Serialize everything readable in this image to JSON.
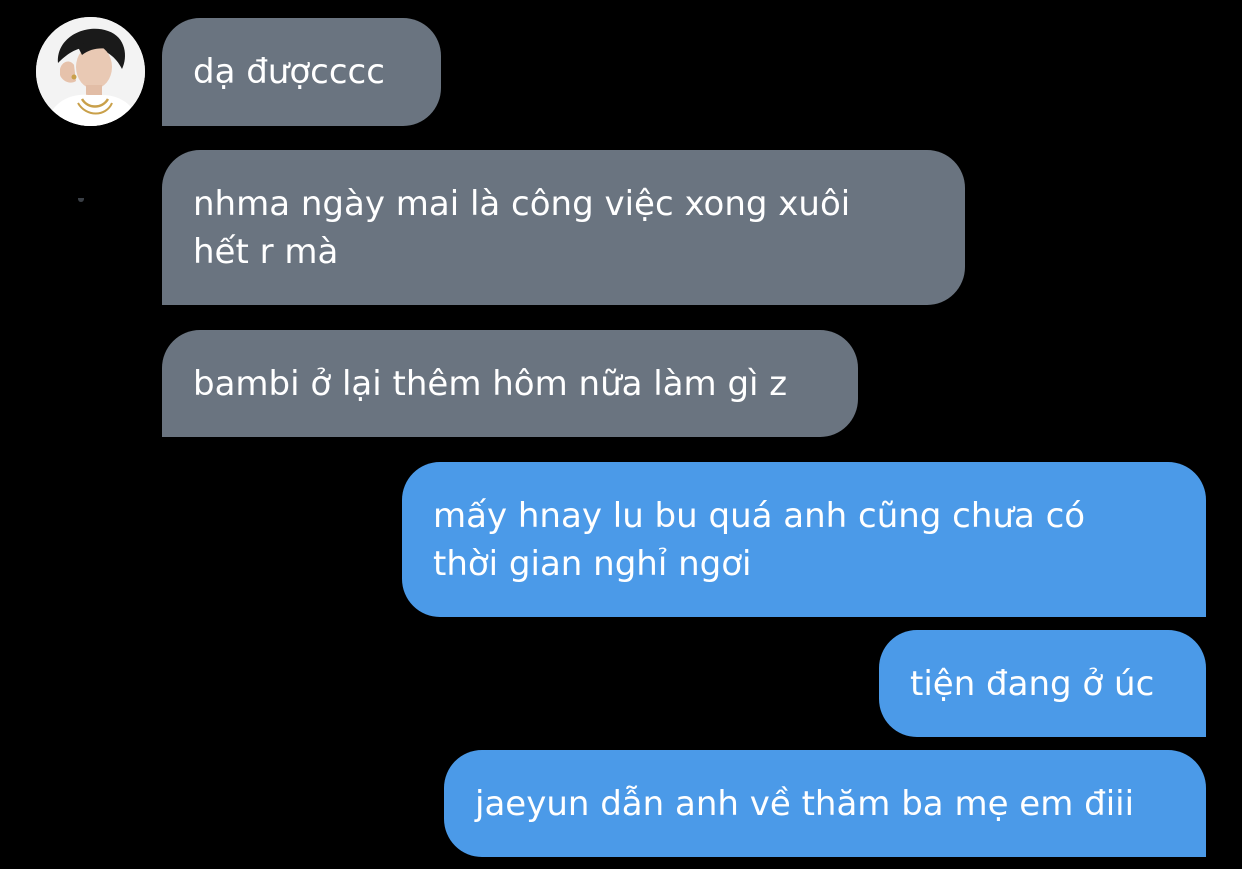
{
  "conversation": {
    "contact": {
      "avatar_icon": "profile-photo"
    },
    "messages": [
      {
        "direction": "incoming",
        "text": "dạ đượcccc"
      },
      {
        "direction": "incoming",
        "text": "nhma ngày mai là công việc xong xuôi\nhết r mà"
      },
      {
        "direction": "incoming",
        "text": "bambi ở lại thêm hôm nữa làm gì z"
      },
      {
        "direction": "outgoing",
        "text": "mấy hnay lu bu quá anh cũng chưa có\nthời gian nghỉ ngơi"
      },
      {
        "direction": "outgoing",
        "text": "tiện đang ở úc"
      },
      {
        "direction": "outgoing",
        "text": "jaeyun dẫn anh về thăm ba mẹ em điii"
      }
    ]
  },
  "colors": {
    "background": "#000000",
    "incoming_bubble": "#6a7480",
    "outgoing_bubble": "#4b9ae8",
    "text": "#ffffff"
  }
}
